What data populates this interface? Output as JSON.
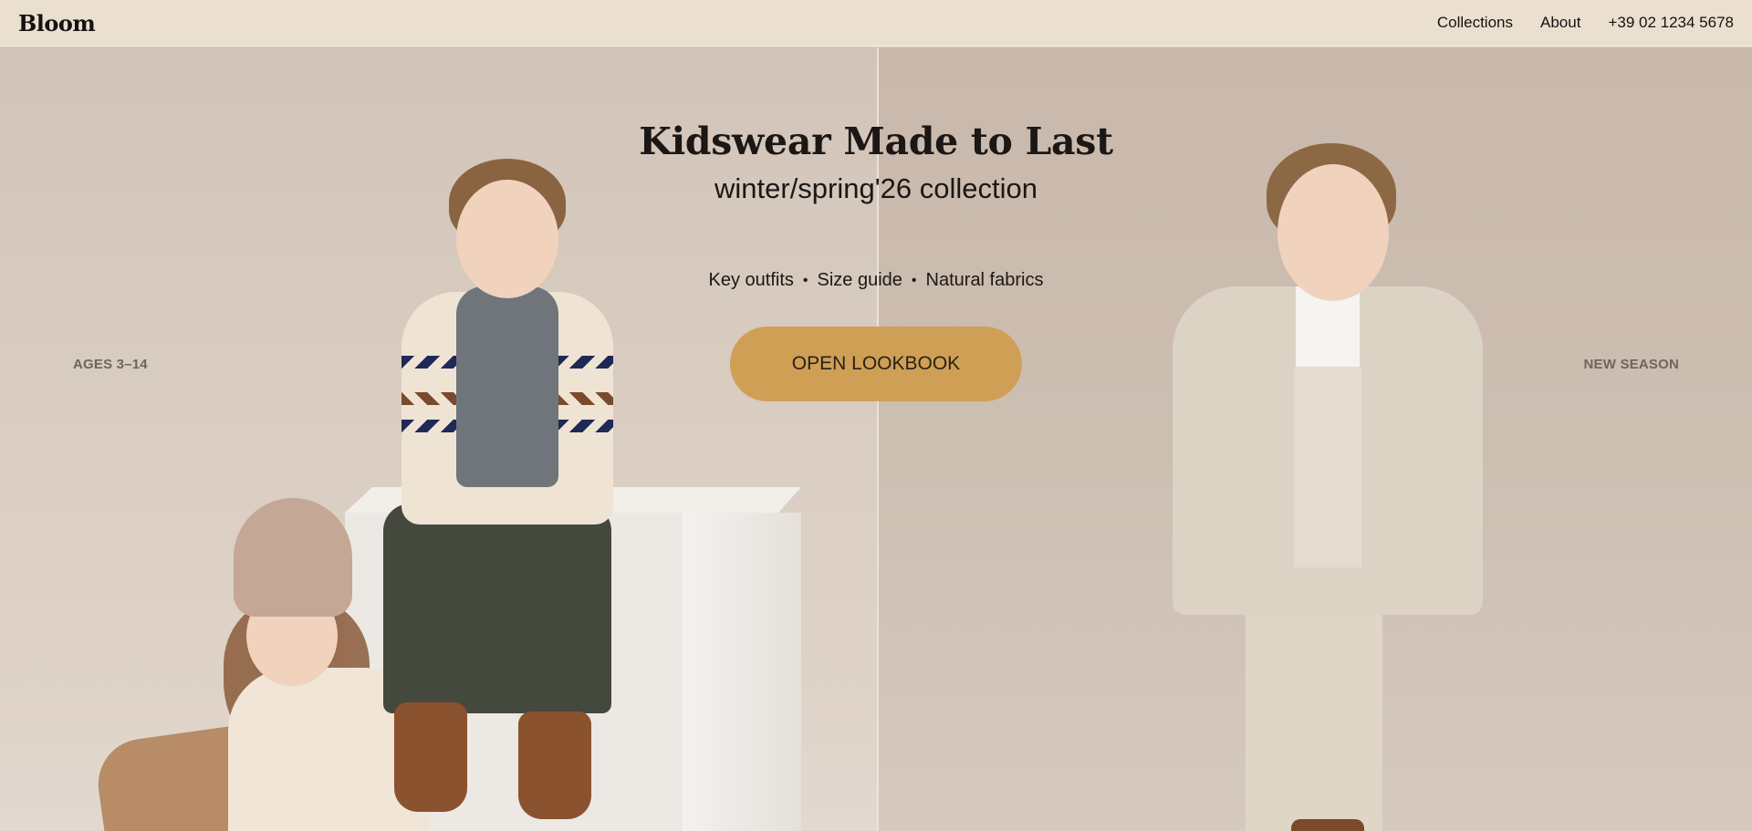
{
  "brand": {
    "name": "Bloom"
  },
  "nav": {
    "items": [
      {
        "label": "Collections"
      },
      {
        "label": "About"
      },
      {
        "label": "+39 02 1234 5678"
      }
    ]
  },
  "hero": {
    "title": "Kidswear Made to Last",
    "subtitle": "winter/spring'26 collection",
    "links": [
      "Key outfits",
      "Size guide",
      "Natural fabrics"
    ],
    "separator": "•",
    "cta_label": "OPEN LOOKBOOK",
    "left_label": "AGES 3–14",
    "right_label": "NEW SEASON"
  },
  "colors": {
    "header_bg": "#ebe0d0",
    "cta_bg": "#cf9f56",
    "text": "#1c1714",
    "side_label": "#6e655d"
  }
}
